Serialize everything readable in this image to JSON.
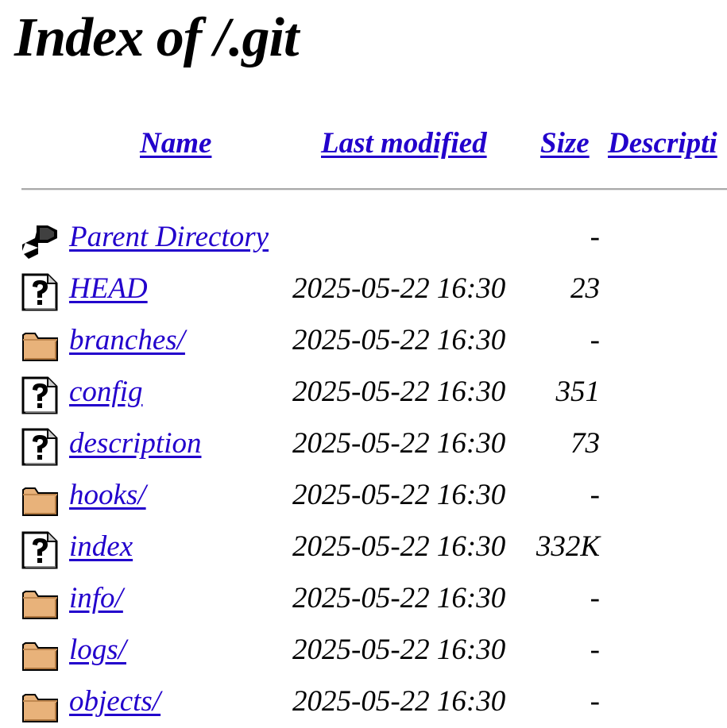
{
  "page": {
    "title": "Index of /.git"
  },
  "columns": {
    "name": "Name",
    "last_modified": "Last modified",
    "size": "Size",
    "description": "Descripti"
  },
  "entries": [
    {
      "icon": "back-icon",
      "name": "Parent Directory",
      "modified": "",
      "size": "-"
    },
    {
      "icon": "unknown-file-icon",
      "name": "HEAD",
      "modified": "2025-05-22 16:30",
      "size": "23"
    },
    {
      "icon": "folder-icon",
      "name": "branches/",
      "modified": "2025-05-22 16:30",
      "size": "-"
    },
    {
      "icon": "unknown-file-icon",
      "name": "config",
      "modified": "2025-05-22 16:30",
      "size": "351"
    },
    {
      "icon": "unknown-file-icon",
      "name": "description",
      "modified": "2025-05-22 16:30",
      "size": "73"
    },
    {
      "icon": "folder-icon",
      "name": "hooks/",
      "modified": "2025-05-22 16:30",
      "size": "-"
    },
    {
      "icon": "unknown-file-icon",
      "name": "index",
      "modified": "2025-05-22 16:30",
      "size": "332K"
    },
    {
      "icon": "folder-icon",
      "name": "info/",
      "modified": "2025-05-22 16:30",
      "size": "-"
    },
    {
      "icon": "folder-icon",
      "name": "logs/",
      "modified": "2025-05-22 16:30",
      "size": "-"
    },
    {
      "icon": "folder-icon",
      "name": "objects/",
      "modified": "2025-05-22 16:30",
      "size": "-"
    }
  ],
  "colors": {
    "link": "#2200cc",
    "divider": "#a9a9a9",
    "folder": "#e8b27a"
  }
}
